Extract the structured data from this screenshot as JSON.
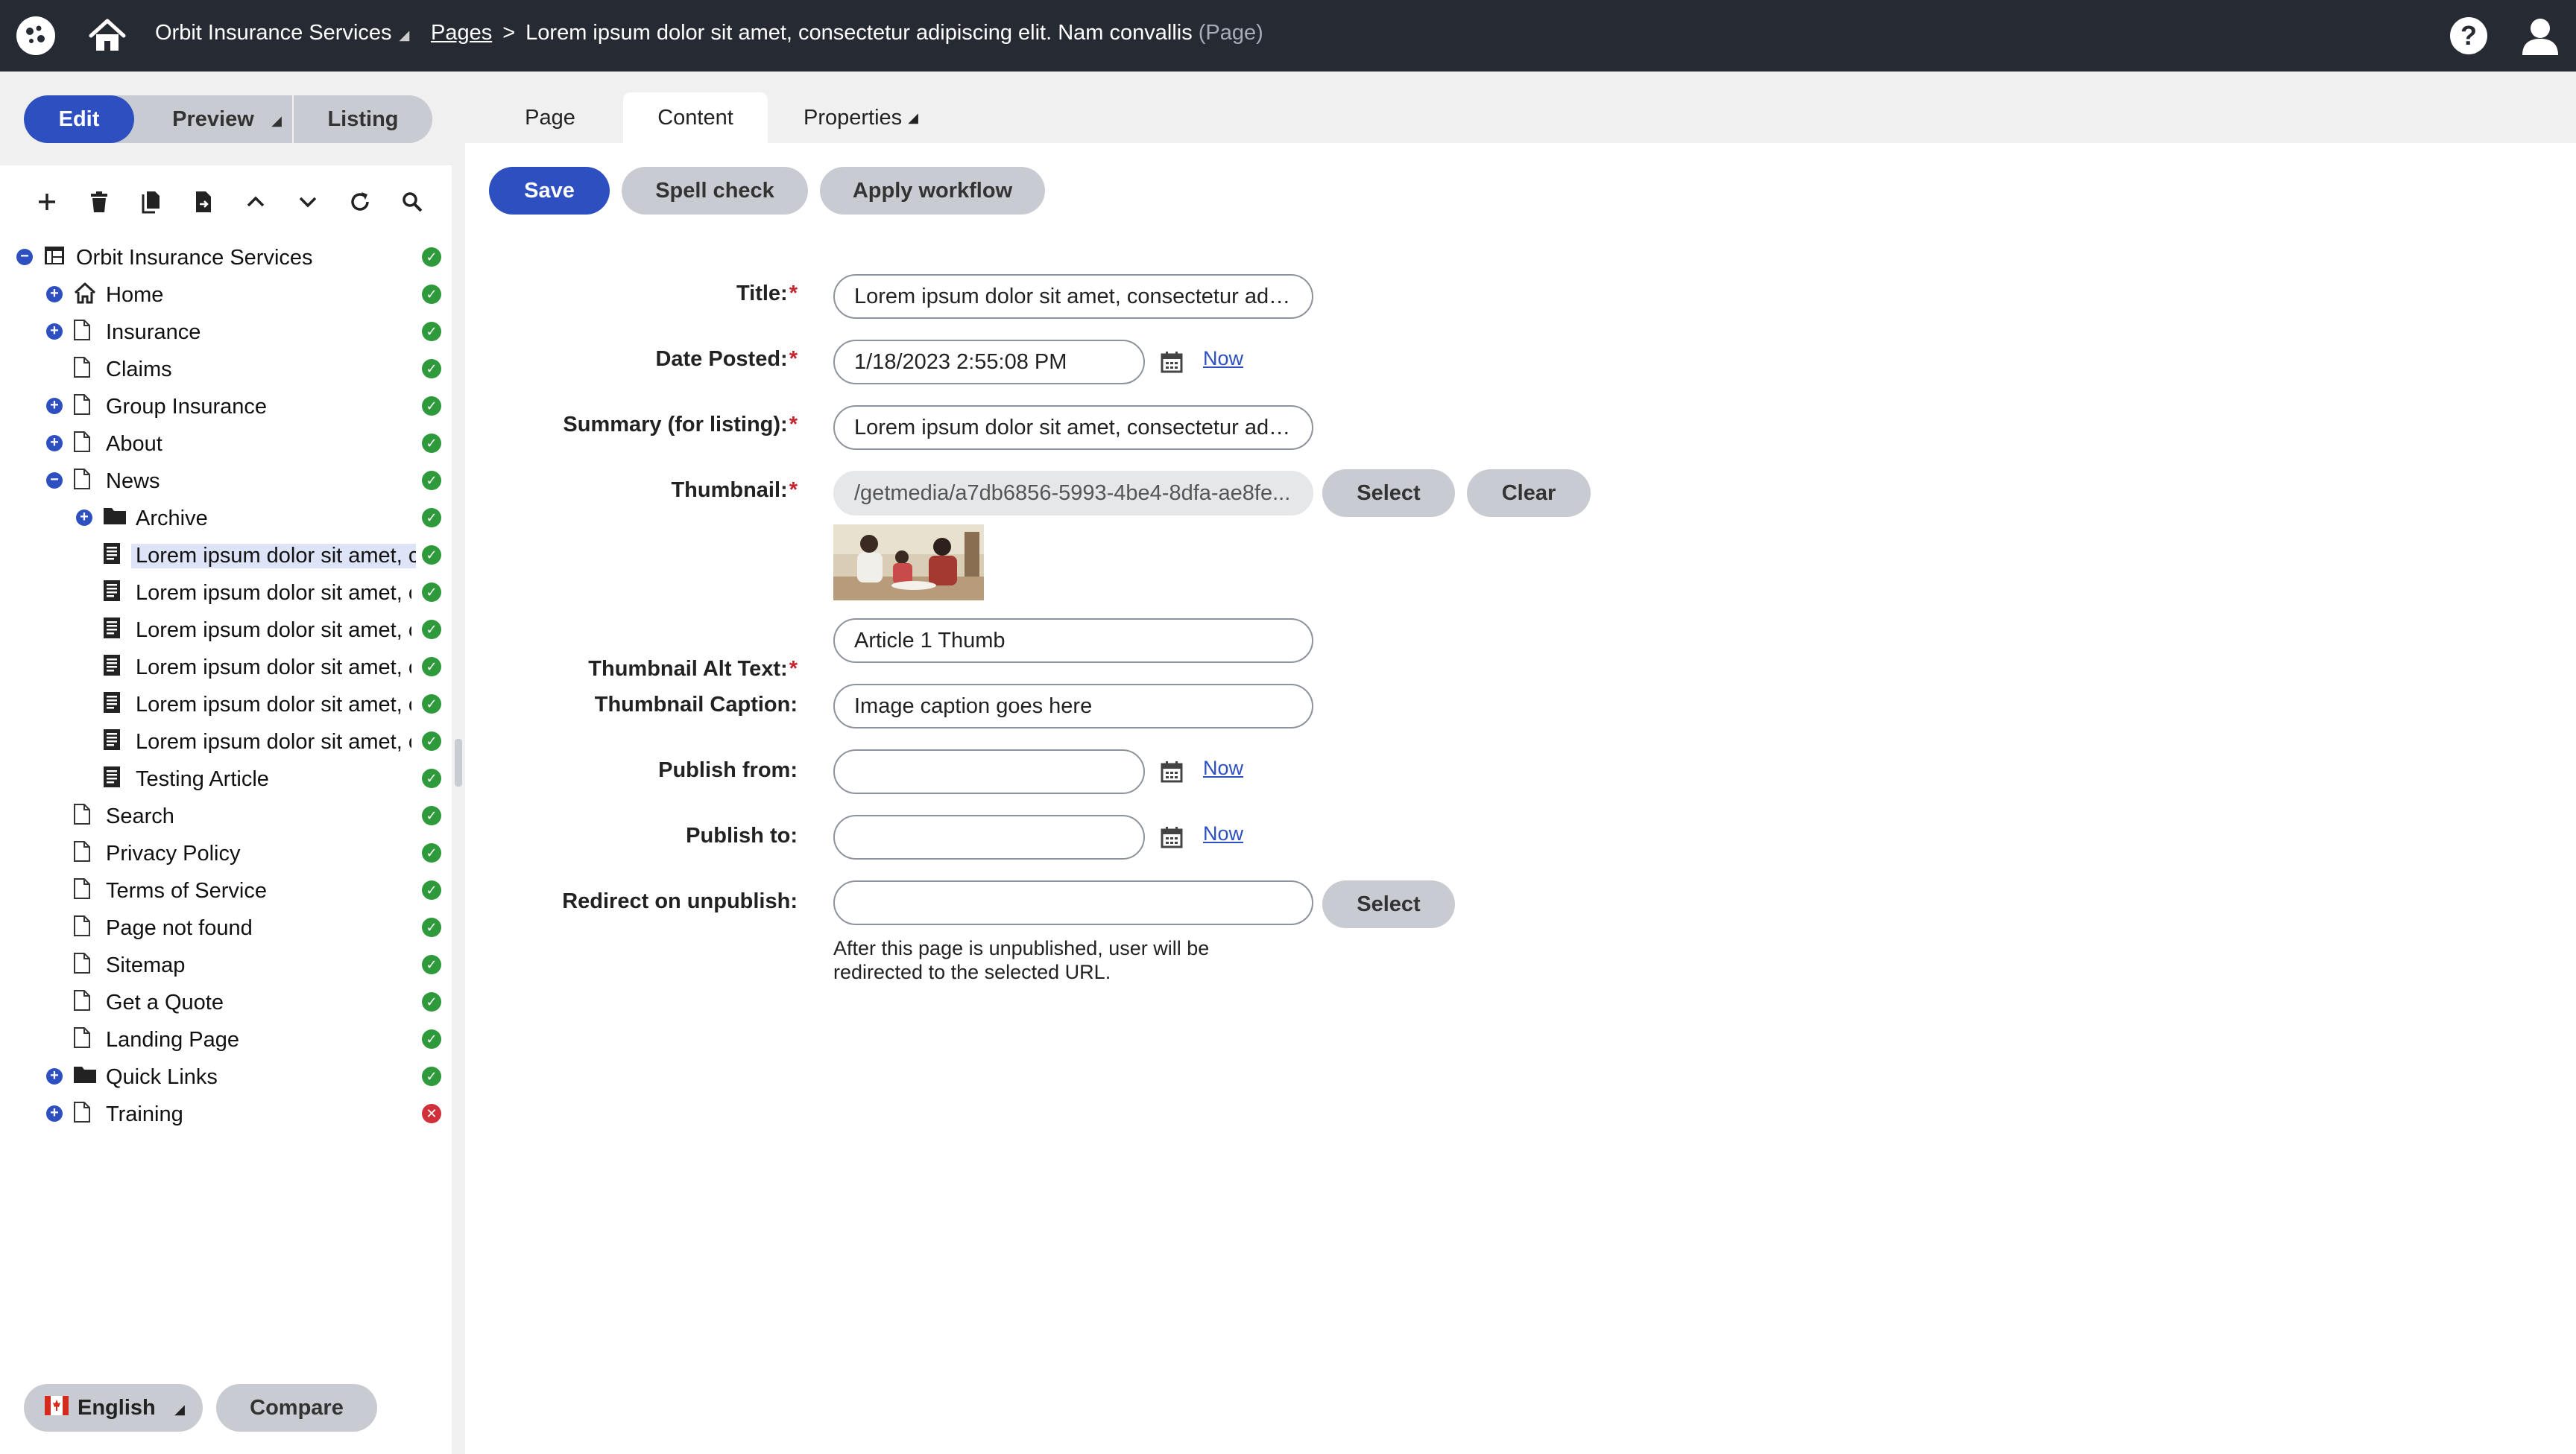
{
  "header": {
    "site_name": "Orbit Insurance Services",
    "breadcrumb_root": "Pages",
    "breadcrumb_current": "Lorem ipsum dolor sit amet, consectetur adipiscing elit. Nam convallis",
    "breadcrumb_type": "(Page)",
    "icons": [
      "app-logo-icon",
      "home-icon",
      "help-icon",
      "user-icon"
    ]
  },
  "modes": {
    "edit": "Edit",
    "preview": "Preview",
    "listing": "Listing",
    "active": "Edit"
  },
  "tabs": [
    {
      "label": "Page"
    },
    {
      "label": "Content",
      "active": true
    },
    {
      "label": "Properties"
    }
  ],
  "tree_toolbar": [
    "add-icon",
    "delete-icon",
    "copy-icon",
    "move-icon",
    "move-up-icon",
    "move-down-icon",
    "refresh-icon",
    "search-icon"
  ],
  "tree": [
    {
      "label": "Orbit Insurance Services",
      "status": "published"
    },
    {
      "label": "Home",
      "status": "published"
    },
    {
      "label": "Insurance",
      "status": "published"
    },
    {
      "label": "Claims",
      "status": "published"
    },
    {
      "label": "Group Insurance",
      "status": "published"
    },
    {
      "label": "About",
      "status": "published"
    },
    {
      "label": "News",
      "status": "published"
    },
    {
      "label": "Archive",
      "status": "published"
    },
    {
      "label": "Lorem ipsum dolor sit amet, c",
      "status": "published",
      "selected": true
    },
    {
      "label": "Lorem ipsum dolor sit amet, c",
      "status": "published"
    },
    {
      "label": "Lorem ipsum dolor sit amet, c",
      "status": "published"
    },
    {
      "label": "Lorem ipsum dolor sit amet, c",
      "status": "published"
    },
    {
      "label": "Lorem ipsum dolor sit amet, c",
      "status": "published"
    },
    {
      "label": "Lorem ipsum dolor sit amet, c",
      "status": "published"
    },
    {
      "label": "Testing Article",
      "status": "published"
    },
    {
      "label": "Search",
      "status": "published"
    },
    {
      "label": "Privacy Policy",
      "status": "published"
    },
    {
      "label": "Terms of Service",
      "status": "published"
    },
    {
      "label": "Page not found",
      "status": "published"
    },
    {
      "label": "Sitemap",
      "status": "published"
    },
    {
      "label": "Get a Quote",
      "status": "published"
    },
    {
      "label": "Landing Page",
      "status": "published"
    },
    {
      "label": "Quick Links",
      "status": "published"
    },
    {
      "label": "Training",
      "status": "error"
    }
  ],
  "footer": {
    "language": "English",
    "compare": "Compare"
  },
  "actions": {
    "save": "Save",
    "spell_check": "Spell check",
    "apply_workflow": "Apply workflow"
  },
  "form": {
    "title_label": "Title:",
    "title_value": "Lorem ipsum dolor sit amet, consectetur adipiscing elit. Nam convallis",
    "date_posted_label": "Date Posted:",
    "date_posted_value": "1/18/2023 2:55:08 PM",
    "now_link": "Now",
    "summary_label": "Summary (for listing):",
    "summary_value": "Lorem ipsum dolor sit amet, consectetur adipiscing elit.",
    "thumbnail_label": "Thumbnail:",
    "thumbnail_value": "/getmedia/a7db6856-5993-4be4-8dfa-ae8fe...",
    "select_label": "Select",
    "clear_label": "Clear",
    "thumb_alt_label": "Thumbnail Alt Text:",
    "thumb_alt_value": "Article 1 Thumb",
    "thumb_caption_label": "Thumbnail Caption:",
    "thumb_caption_value": "Image caption goes here",
    "publish_from_label": "Publish from:",
    "publish_from_value": "",
    "publish_to_label": "Publish to:",
    "publish_to_value": "",
    "redirect_label": "Redirect on unpublish:",
    "redirect_value": "",
    "redirect_note": "After this page is unpublished, user will be redirected to the selected URL."
  },
  "colors": {
    "header_bg": "#262b33",
    "accent": "#2d4fbf",
    "status_ok": "#2e9a3c",
    "status_error": "#d0303a",
    "button_grey": "#c8ccd2",
    "required": "#c5232c"
  }
}
